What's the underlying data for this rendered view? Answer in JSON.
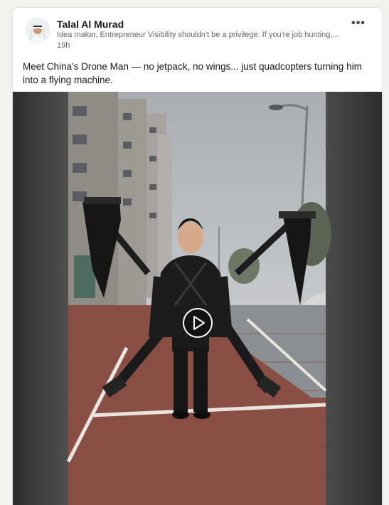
{
  "post": {
    "author": {
      "name": "Talal Al Murad",
      "headline": "Idea maker, Entrepreneur Visibility shouldn't be a privilege. If you're job hunting,...",
      "time": "19h"
    },
    "more_label": "•••",
    "text": "Meet China's Drone Man — no jetpack, no wings... just quadcopters turning him into a flying machine."
  },
  "video": {
    "play_icon": "play-icon"
  }
}
